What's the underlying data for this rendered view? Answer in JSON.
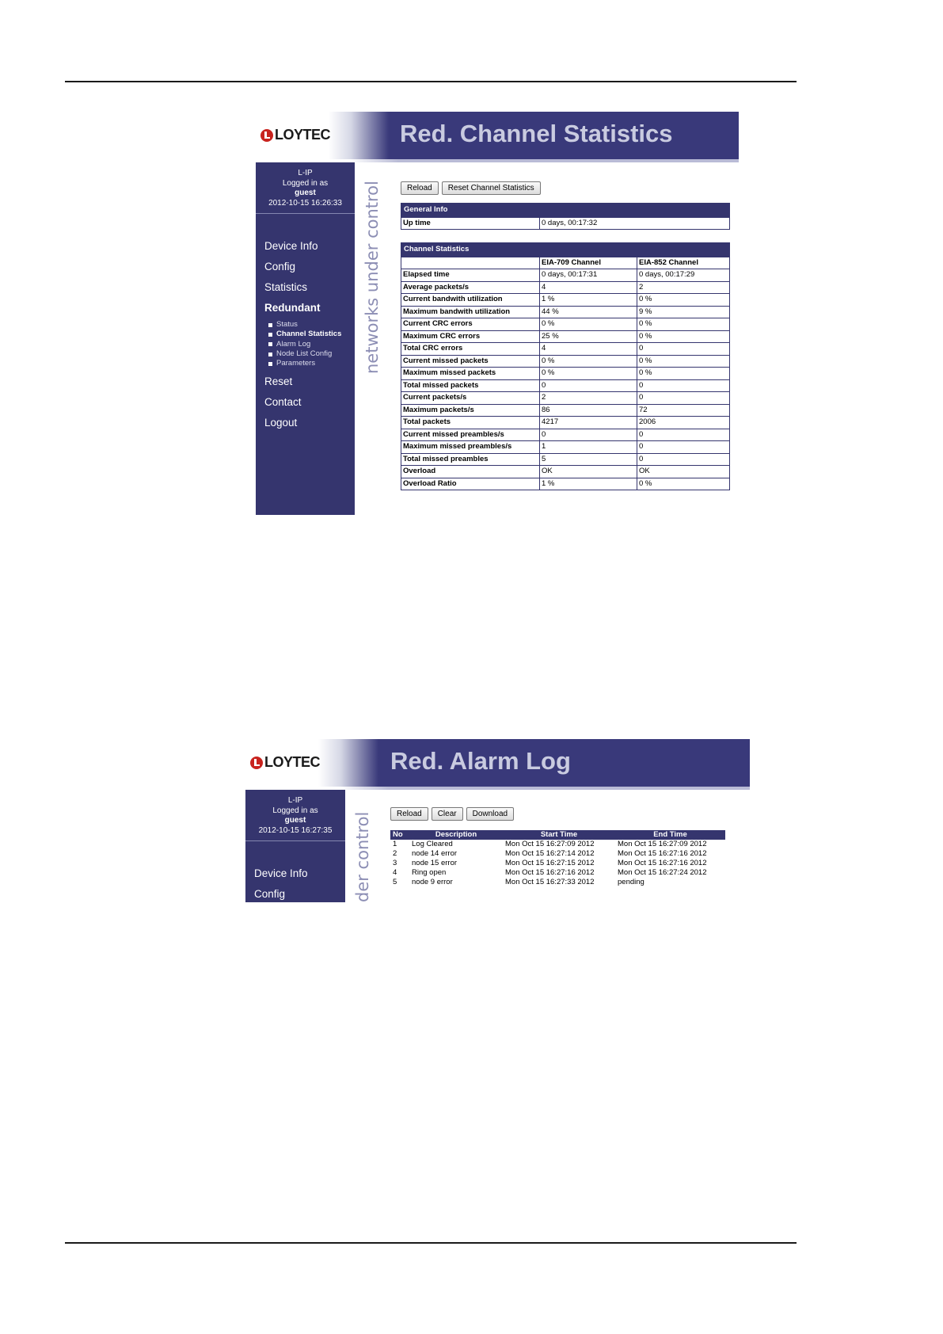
{
  "screenshot1": {
    "logo": "LOYTEC",
    "title": "Red. Channel Statistics",
    "login": {
      "device": "L-IP",
      "logged_in_as": "Logged in as",
      "user": "guest",
      "timestamp": "2012-10-15 16:26:33"
    },
    "menu": [
      "Device Info",
      "Config",
      "Statistics",
      "Redundant"
    ],
    "submenu": [
      "Status",
      "Channel Statistics",
      "Alarm Log",
      "Node List Config",
      "Parameters"
    ],
    "menu_after": [
      "Reset",
      "Contact",
      "Logout"
    ],
    "tagline": "networks under control",
    "buttons": {
      "reload": "Reload",
      "reset": "Reset Channel Statistics"
    },
    "general_info": {
      "title": "General Info",
      "label": "Up time",
      "value": "0 days, 00:17:32"
    },
    "channel_stats": {
      "title": "Channel Statistics",
      "columns": [
        "EIA-709 Channel",
        "EIA-852 Channel"
      ],
      "rows": [
        [
          "Elapsed time",
          "0 days, 00:17:31",
          "0 days, 00:17:29"
        ],
        [
          "Average packets/s",
          "4",
          "2"
        ],
        [
          "Current bandwith utilization",
          "1 %",
          "0 %"
        ],
        [
          "Maximum bandwith utilization",
          "44 %",
          "9 %"
        ],
        [
          "Current CRC errors",
          "0 %",
          "0 %"
        ],
        [
          "Maximum CRC errors",
          "25 %",
          "0 %"
        ],
        [
          "Total CRC errors",
          "4",
          "0"
        ],
        [
          "Current missed packets",
          "0 %",
          "0 %"
        ],
        [
          "Maximum missed packets",
          "0 %",
          "0 %"
        ],
        [
          "Total missed packets",
          "0",
          "0"
        ],
        [
          "Current packets/s",
          "2",
          "0"
        ],
        [
          "Maximum packets/s",
          "86",
          "72"
        ],
        [
          "Total packets",
          "4217",
          "2006"
        ],
        [
          "Current missed preambles/s",
          "0",
          "0"
        ],
        [
          "Maximum missed preambles/s",
          "1",
          "0"
        ],
        [
          "Total missed preambles",
          "5",
          "0"
        ],
        [
          "Overload",
          "OK",
          "OK"
        ],
        [
          "Overload Ratio",
          "1 %",
          "0 %"
        ]
      ]
    }
  },
  "screenshot2": {
    "logo": "LOYTEC",
    "title": "Red. Alarm Log",
    "login": {
      "device": "L-IP",
      "logged_in_as": "Logged in as",
      "user": "guest",
      "timestamp": "2012-10-15 16:27:35"
    },
    "menu": [
      "Device Info",
      "Config"
    ],
    "tagline": "der control",
    "buttons": {
      "reload": "Reload",
      "clear": "Clear",
      "download": "Download"
    },
    "log": {
      "headers": [
        "No",
        "Description",
        "Start Time",
        "End Time"
      ],
      "rows": [
        [
          "1",
          "Log Cleared",
          "Mon Oct 15 16:27:09 2012",
          "Mon Oct 15 16:27:09 2012"
        ],
        [
          "2",
          "node 14 error",
          "Mon Oct 15 16:27:14 2012",
          "Mon Oct 15 16:27:16 2012"
        ],
        [
          "3",
          "node 15 error",
          "Mon Oct 15 16:27:15 2012",
          "Mon Oct 15 16:27:16 2012"
        ],
        [
          "4",
          "Ring open",
          "Mon Oct 15 16:27:16 2012",
          "Mon Oct 15 16:27:24 2012"
        ],
        [
          "5",
          "node 9 error",
          "Mon Oct 15 16:27:33 2012",
          "pending"
        ]
      ]
    }
  }
}
